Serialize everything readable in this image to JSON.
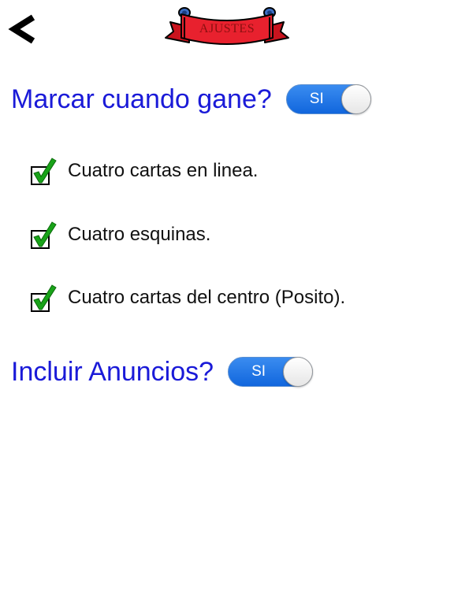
{
  "header": {
    "back_icon": "chevron-left-icon",
    "title": "AJUSTES",
    "banner_color": "#e8212e"
  },
  "settings": {
    "mark_win": {
      "label": "Marcar cuando gane?",
      "toggle_text": "SI",
      "enabled": true
    },
    "options": [
      {
        "label": "Cuatro cartas en linea.",
        "checked": true
      },
      {
        "label": "Cuatro esquinas.",
        "checked": true
      },
      {
        "label": "Cuatro cartas del centro (Posito).",
        "checked": true
      }
    ],
    "ads": {
      "label": "Incluir Anuncios?",
      "toggle_text": "SI",
      "enabled": true
    }
  },
  "colors": {
    "label_blue": "#1a1ad8",
    "toggle_blue": "#1a73e8",
    "check_green": "#19a319"
  }
}
